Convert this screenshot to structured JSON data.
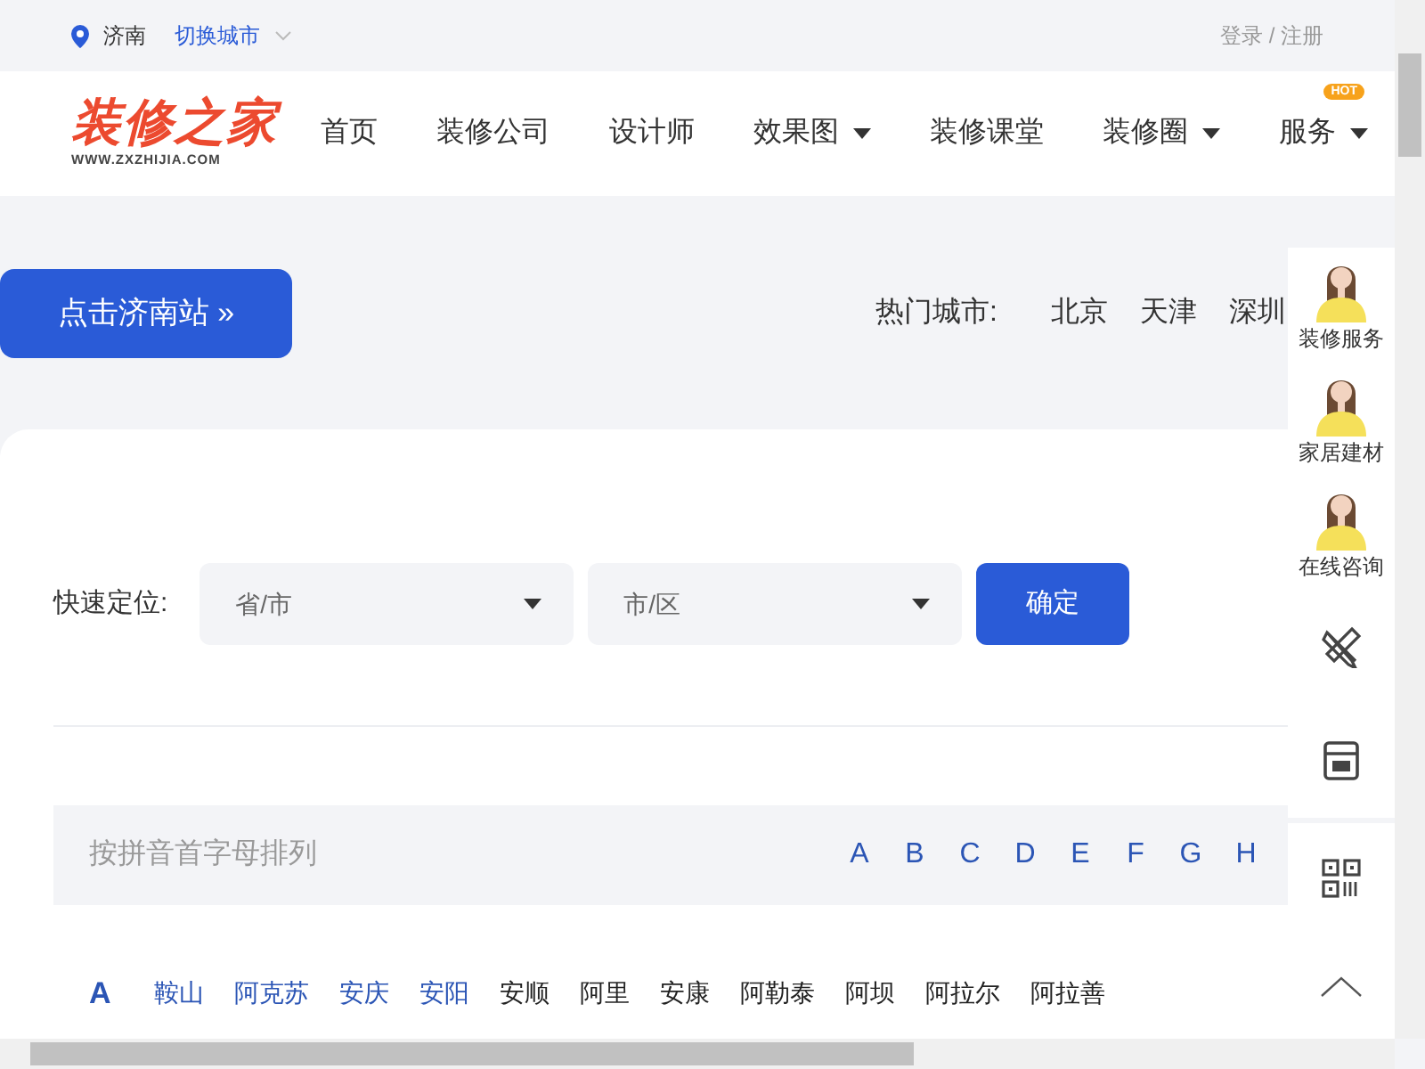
{
  "top_bar": {
    "city": "济南",
    "switch_city": "切换城市",
    "auth": "登录 / 注册"
  },
  "header": {
    "logo": {
      "name": "装修之家",
      "url": "WWW.ZXZHIJIA.COM"
    },
    "nav": [
      {
        "label": "首页",
        "dropdown": false
      },
      {
        "label": "装修公司",
        "dropdown": false
      },
      {
        "label": "设计师",
        "dropdown": false
      },
      {
        "label": "效果图",
        "dropdown": true
      },
      {
        "label": "装修课堂",
        "dropdown": false
      },
      {
        "label": "装修圈",
        "dropdown": true
      },
      {
        "label": "服务",
        "dropdown": true,
        "badge": "HOT"
      }
    ]
  },
  "station_button": "点击济南站 »",
  "hot_cities": {
    "label": "热门城市:",
    "cities": [
      "北京",
      "天津",
      "深圳"
    ]
  },
  "locator": {
    "label": "快速定位:",
    "selects": [
      {
        "placeholder": "省/市"
      },
      {
        "placeholder": "市/区"
      }
    ],
    "confirm": "确定"
  },
  "letter_index": {
    "label": "按拼音首字母排列",
    "letters": [
      "A",
      "B",
      "C",
      "D",
      "E",
      "F",
      "G",
      "H"
    ]
  },
  "city_groups": [
    {
      "letter": "A",
      "cities": [
        {
          "name": "鞍山",
          "color": "#2b55b5"
        },
        {
          "name": "阿克苏",
          "color": "#2b55b5"
        },
        {
          "name": "安庆",
          "color": "#2b55b5"
        },
        {
          "name": "安阳",
          "color": "#2b55b5"
        },
        {
          "name": "安顺",
          "color": "#222222"
        },
        {
          "name": "阿里",
          "color": "#222222"
        },
        {
          "name": "安康",
          "color": "#222222"
        },
        {
          "name": "阿勒泰",
          "color": "#222222"
        },
        {
          "name": "阿坝",
          "color": "#222222"
        },
        {
          "name": "阿拉尔",
          "color": "#222222"
        },
        {
          "name": "阿拉善",
          "color": "#222222"
        }
      ]
    }
  ],
  "side_panel": {
    "consultants": [
      {
        "label": "装修服务"
      },
      {
        "label": "家居建材"
      },
      {
        "label": "在线咨询"
      }
    ]
  }
}
